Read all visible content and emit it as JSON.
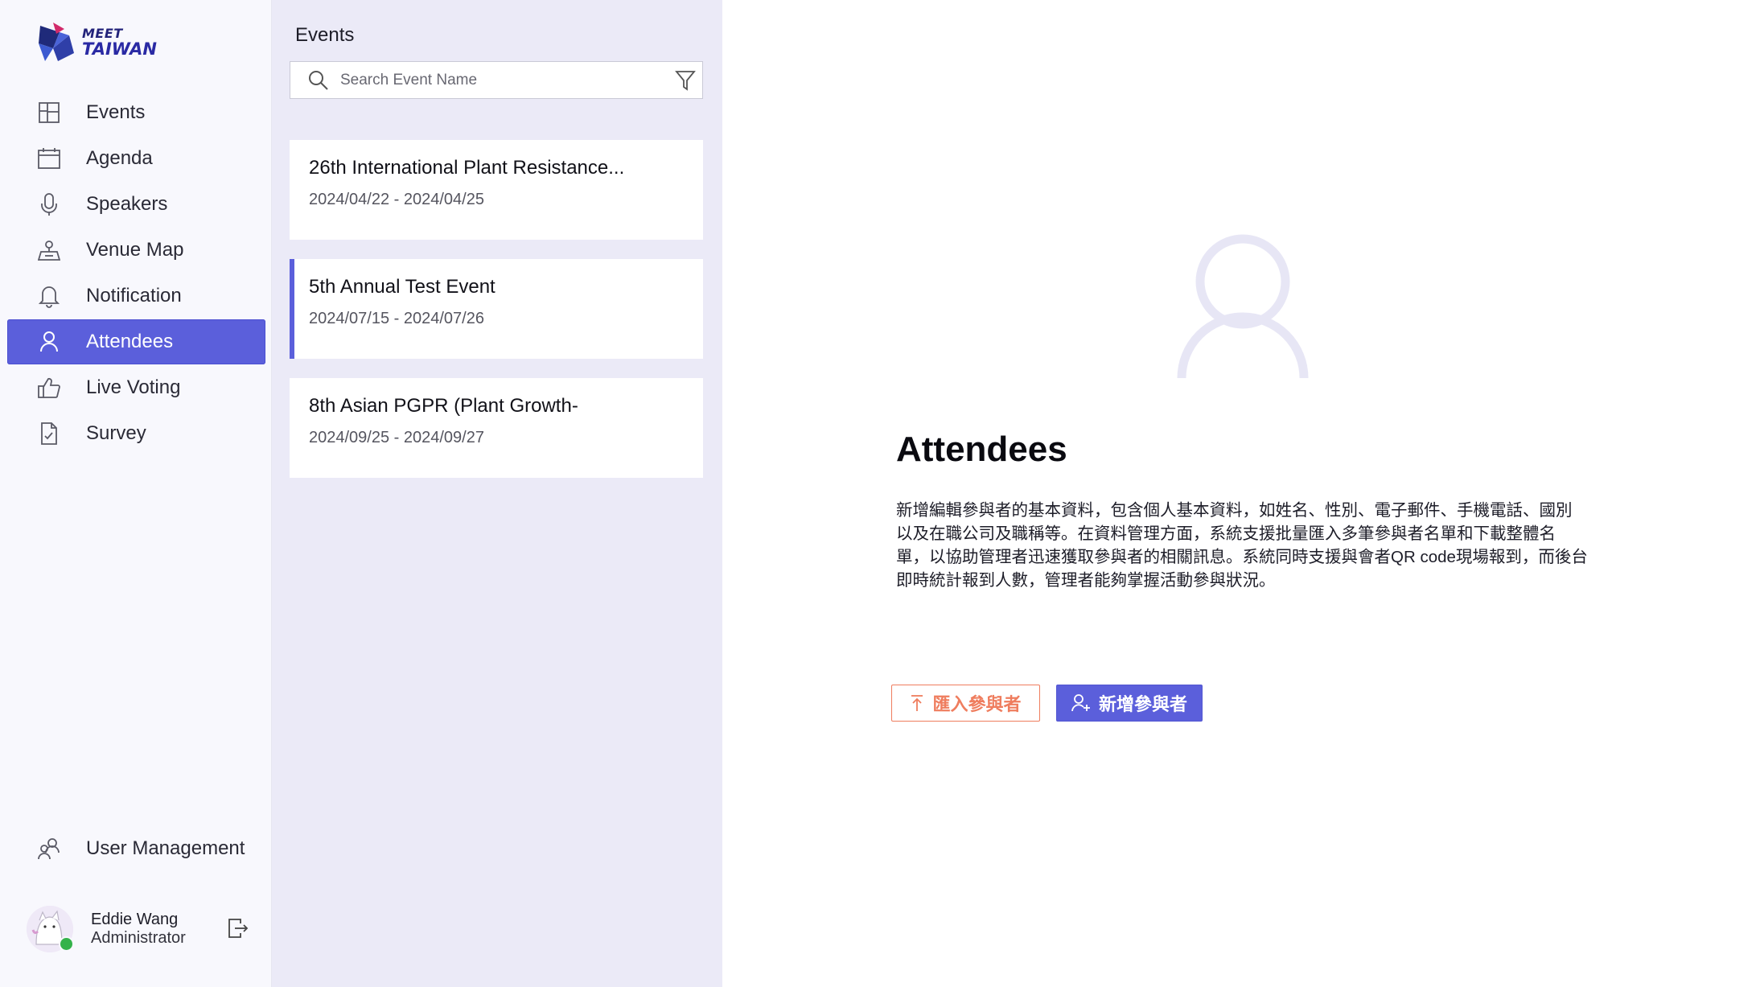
{
  "brand": {
    "line1": "MEET",
    "line2": "TAIWAN"
  },
  "sidebar": {
    "items": [
      {
        "label": "Events",
        "icon": "events-icon"
      },
      {
        "label": "Agenda",
        "icon": "calendar-icon"
      },
      {
        "label": "Speakers",
        "icon": "microphone-icon"
      },
      {
        "label": "Venue Map",
        "icon": "venue-map-icon"
      },
      {
        "label": "Notification",
        "icon": "bell-icon"
      },
      {
        "label": "Attendees",
        "icon": "person-icon",
        "active": true
      },
      {
        "label": "Live Voting",
        "icon": "thumbs-up-icon"
      },
      {
        "label": "Survey",
        "icon": "survey-icon"
      }
    ],
    "user_management": {
      "label": "User Management",
      "icon": "users-icon"
    },
    "profile": {
      "name": "Eddie Wang",
      "role": "Administrator",
      "status_color": "#34b24a"
    }
  },
  "events_panel": {
    "title": "Events",
    "search": {
      "placeholder": "Search Event Name",
      "value": ""
    },
    "events": [
      {
        "title": "26th International Plant Resistance...",
        "dates": "2024/04/22 - 2024/04/25",
        "selected": false
      },
      {
        "title": "5th Annual Test Event",
        "dates": "2024/07/15 - 2024/07/26",
        "selected": true
      },
      {
        "title": "8th Asian PGPR (Plant Growth-",
        "dates": "2024/09/25 - 2024/09/27",
        "selected": false
      }
    ]
  },
  "main": {
    "title": "Attendees",
    "description": "新增編輯參與者的基本資料，包含個人基本資料，如姓名、性別、電子郵件、手機電話、國別以及在職公司及職稱等。在資料管理方面，系統支援批量匯入多筆參與者名單和下載整體名單，以協助管理者迅速獲取參與者的相關訊息。系統同時支援與會者QR code現場報到，而後台即時統計報到人數，管理者能夠掌握活動參與狀況。",
    "import_button": "匯入參與者",
    "add_button": "新增參與者"
  },
  "colors": {
    "accent": "#5b5fdb",
    "import": "#ef7d5e",
    "panel_bg": "#ebeaf7",
    "sidebar_bg": "#f8f8fd"
  }
}
